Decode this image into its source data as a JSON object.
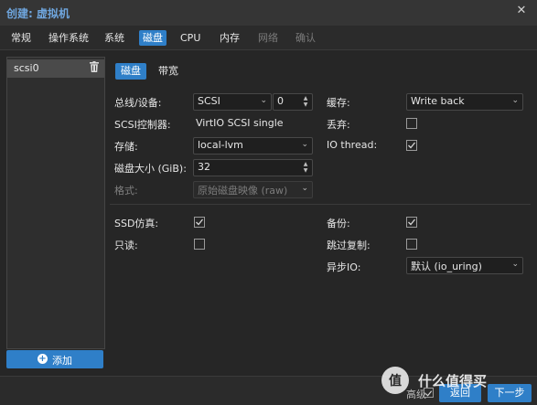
{
  "window": {
    "title": "创建: 虚拟机"
  },
  "tabs": [
    {
      "label": "常规"
    },
    {
      "label": "操作系统"
    },
    {
      "label": "系统"
    },
    {
      "label": "磁盘"
    },
    {
      "label": "CPU"
    },
    {
      "label": "内存"
    },
    {
      "label": "网络"
    },
    {
      "label": "确认"
    }
  ],
  "disk_list": {
    "items": [
      {
        "label": "scsi0"
      }
    ],
    "add_label": "添加"
  },
  "subtabs": [
    {
      "label": "磁盘"
    },
    {
      "label": "带宽"
    }
  ],
  "form": {
    "bus": {
      "label": "总线/设备:",
      "value": "SCSI",
      "device": "0"
    },
    "scsi_controller": {
      "label": "SCSI控制器:",
      "value": "VirtIO SCSI single"
    },
    "storage": {
      "label": "存储:",
      "value": "local-lvm"
    },
    "disk_size": {
      "label": "磁盘大小 (GiB):",
      "value": "32"
    },
    "format": {
      "label": "格式:",
      "value": "原始磁盘映像 (raw)"
    },
    "cache": {
      "label": "缓存:",
      "value": "Write back"
    },
    "discard": {
      "label": "丢弃:",
      "checked": false
    },
    "io_thread": {
      "label": "IO thread:",
      "checked": true
    },
    "ssd": {
      "label": "SSD仿真:",
      "checked": true
    },
    "readonly": {
      "label": "只读:",
      "checked": false
    },
    "backup": {
      "label": "备份:",
      "checked": true
    },
    "skip_replication": {
      "label": "跳过复制:",
      "checked": false
    },
    "async_io": {
      "label": "异步IO:",
      "value": "默认 (io_uring)"
    }
  },
  "footer": {
    "advanced_label": "高级",
    "advanced_checked": true,
    "back_label": "返回",
    "next_label": "下一步"
  },
  "watermark": {
    "text": "值 什么值得买"
  },
  "colors": {
    "accent": "#2f7fc8",
    "title": "#6fa6de",
    "background": "#262626"
  }
}
